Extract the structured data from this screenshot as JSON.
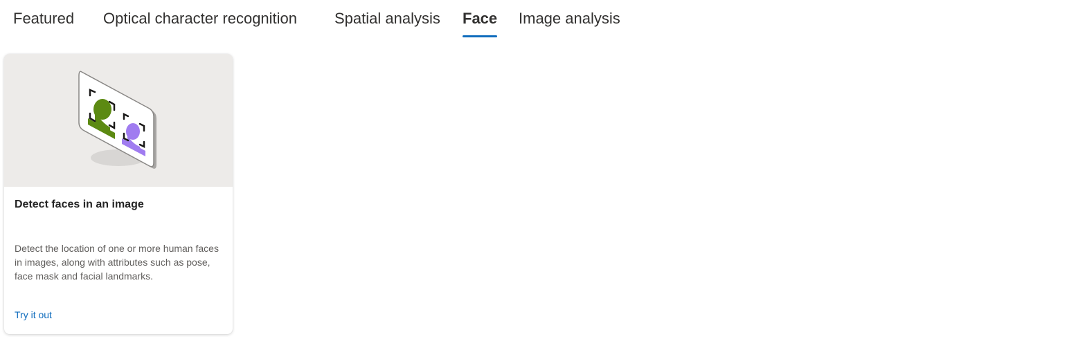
{
  "tabs": [
    {
      "label": "Featured",
      "active": false
    },
    {
      "label": "Optical character recognition",
      "active": false
    },
    {
      "label": "Spatial analysis",
      "active": false
    },
    {
      "label": "Face",
      "active": true
    },
    {
      "label": "Image analysis",
      "active": false
    }
  ],
  "cards": [
    {
      "title": "Detect faces in an image",
      "description": "Detect the location of one or more human faces in images, along with attributes such as pose, face mask and facial landmarks.",
      "link_label": "Try it out",
      "illustration_icon": "face-detection-illustration"
    }
  ],
  "colors": {
    "accent": "#0f6cbd",
    "media_background": "#edebe9",
    "face_green": "#5c8a12",
    "face_purple": "#a07cf0"
  }
}
